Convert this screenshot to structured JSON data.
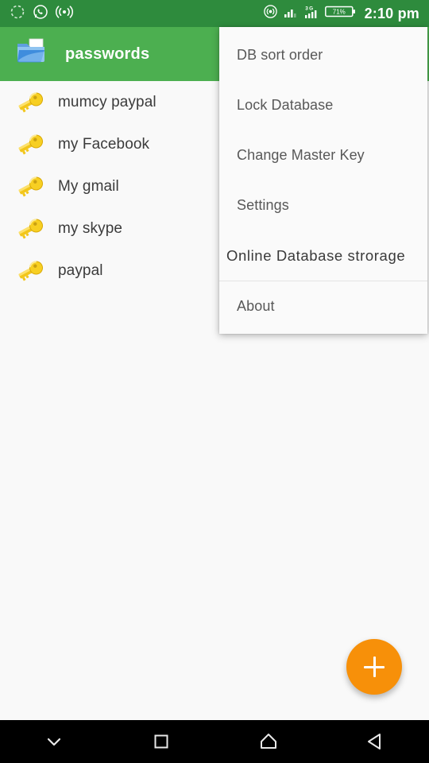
{
  "status_bar": {
    "left_icons": [
      "sync-circle-icon",
      "whatsapp-icon",
      "broadcast-icon"
    ],
    "right_icons": [
      "hotspot-icon",
      "signal-bars-icon",
      "3g-signal-icon",
      "battery-icon"
    ],
    "network_label": "3G",
    "battery_percent": "71%",
    "time": "2:10 pm",
    "background_color": "#2e8b3d"
  },
  "app_bar": {
    "icon": "folder-icon",
    "title": "passwords",
    "background_color": "#4caf50",
    "title_color": "#ffffff"
  },
  "entries": [
    {
      "icon": "key-icon",
      "label": "mumcy paypal"
    },
    {
      "icon": "key-icon",
      "label": "my Facebook"
    },
    {
      "icon": "key-icon",
      "label": "My gmail"
    },
    {
      "icon": "key-icon",
      "label": "my skype"
    },
    {
      "icon": "key-icon",
      "label": "paypal"
    }
  ],
  "overflow_menu": {
    "items": [
      {
        "label": "DB sort order"
      },
      {
        "label": "Lock Database"
      },
      {
        "label": "Change Master Key"
      },
      {
        "label": "Settings"
      },
      {
        "label": "Online Database  strorage"
      },
      {
        "label": "About"
      }
    ],
    "background_color": "#fafafa"
  },
  "fab": {
    "icon": "plus-icon",
    "label": "+",
    "color": "#f79009"
  },
  "nav_bar": {
    "buttons": [
      {
        "icon": "chevron-down-icon"
      },
      {
        "icon": "recents-square-icon"
      },
      {
        "icon": "home-icon"
      },
      {
        "icon": "back-triangle-icon"
      }
    ],
    "background_color": "#000000"
  }
}
